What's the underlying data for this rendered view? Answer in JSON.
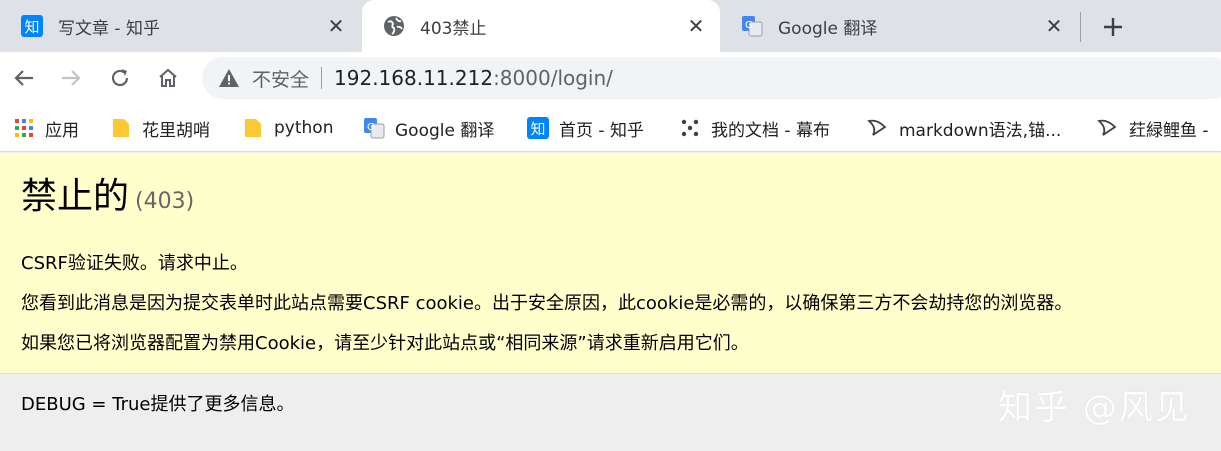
{
  "tabs": [
    {
      "title": "写文章 - 知乎",
      "favicon": "zhihu-icon",
      "active": false
    },
    {
      "title": "403禁止",
      "favicon": "globe-icon",
      "active": true
    },
    {
      "title": "Google 翻译",
      "favicon": "google-translate-icon",
      "active": false
    }
  ],
  "tab_close_glyph": "✕",
  "zhihu_glyph": "知",
  "omnibox": {
    "security_label": "不安全",
    "url_host": "192.168.11.212",
    "url_rest": ":8000/login/"
  },
  "bookmarks": [
    {
      "label": "应用",
      "icon": "apps-grid-icon"
    },
    {
      "label": "花里胡哨",
      "icon": "folder-icon"
    },
    {
      "label": "python",
      "icon": "folder-icon"
    },
    {
      "label": "Google 翻译",
      "icon": "google-translate-icon"
    },
    {
      "label": "首页 - 知乎",
      "icon": "zhihu-icon"
    },
    {
      "label": "我的文档 - 幕布",
      "icon": "mubu-icon"
    },
    {
      "label": "markdown语法,锚...",
      "icon": "fish-icon"
    },
    {
      "label": "荭緑鲤鱼 -",
      "icon": "fish-icon"
    }
  ],
  "page": {
    "heading": "禁止的",
    "status_code": "(403)",
    "lines": [
      "CSRF验证失败。请求中止。",
      "您看到此消息是因为提交表单时此站点需要CSRF cookie。出于安全原因，此cookie是必需的，以确保第三方不会劫持您的浏览器。",
      "如果您已将浏览器配置为禁用Cookie，请至少针对此站点或“相同来源”请求重新启用它们。"
    ],
    "debug_info": "DEBUG = True提供了更多信息。"
  },
  "watermark": "知乎 @风见",
  "colors": {
    "summary_bg": "#ffffcc",
    "info_bg": "#eeeeee",
    "zhihu_blue": "#0084ff",
    "folder_yellow": "#fcc934"
  }
}
